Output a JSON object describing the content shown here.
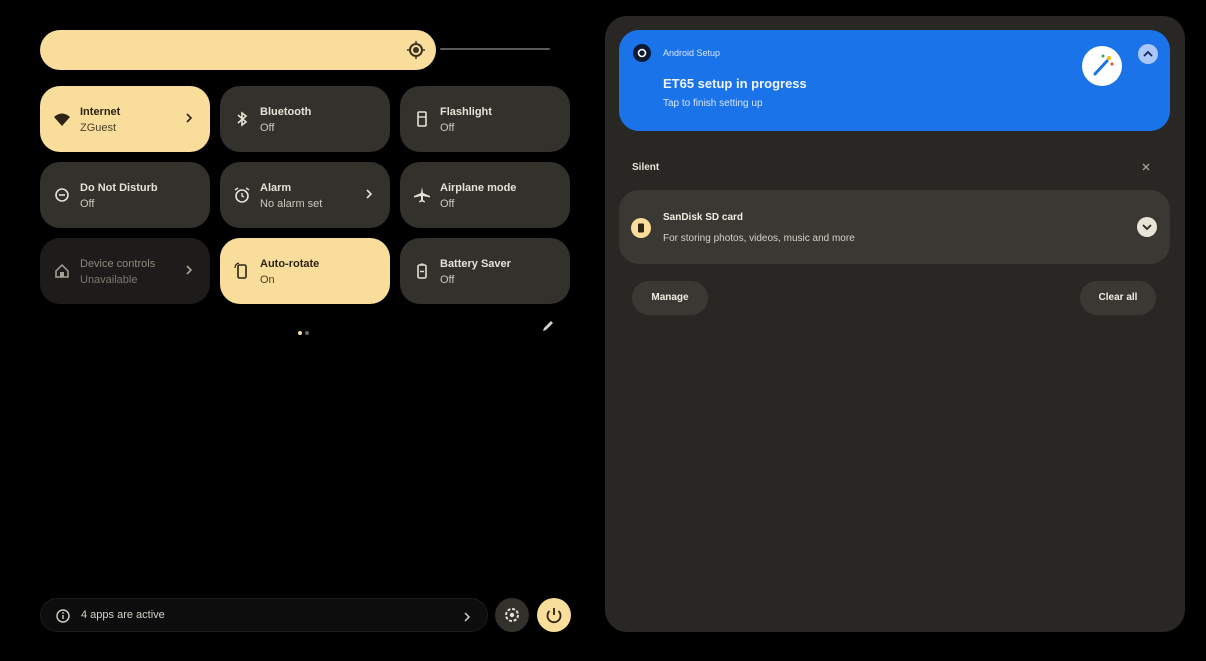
{
  "quick_settings": {
    "tiles": [
      {
        "title": "Internet",
        "subtitle": "ZGuest",
        "icon": "wifi-icon",
        "state": "on",
        "has_chevron": true
      },
      {
        "title": "Bluetooth",
        "subtitle": "Off",
        "icon": "bluetooth-icon",
        "state": "off"
      },
      {
        "title": "Flashlight",
        "subtitle": "Off",
        "icon": "flashlight-icon",
        "state": "off"
      },
      {
        "title": "Do Not Disturb",
        "subtitle": "Off",
        "icon": "do-not-disturb-icon",
        "state": "off"
      },
      {
        "title": "Alarm",
        "subtitle": "No alarm set",
        "icon": "alarm-icon",
        "state": "off",
        "has_chevron": true
      },
      {
        "title": "Airplane mode",
        "subtitle": "Off",
        "icon": "airplane-icon",
        "state": "off"
      },
      {
        "title": "Device controls",
        "subtitle": "Unavailable",
        "icon": "home-icon",
        "state": "unavailable",
        "has_chevron": true
      },
      {
        "title": "Auto-rotate",
        "subtitle": "On",
        "icon": "rotate-icon",
        "state": "on"
      },
      {
        "title": "Battery Saver",
        "subtitle": "Off",
        "icon": "battery-icon",
        "state": "off"
      }
    ],
    "page_indicator": {
      "pages": 2,
      "current": 1
    },
    "footer": {
      "active_apps_text": "4 apps are active"
    }
  },
  "notifications": {
    "setup": {
      "app_name": "Android Setup",
      "title": "ET65 setup in progress",
      "subtitle": "Tap to finish setting up"
    },
    "section_label": "Silent",
    "sd_card": {
      "title": "SanDisk SD card",
      "subtitle": "For storing photos, videos, music and more"
    },
    "actions": {
      "manage": "Manage",
      "clear_all": "Clear all"
    }
  },
  "colors": {
    "accent": "#f9dd9a",
    "tile_off": "#33312c",
    "setup_blue": "#1a73e8",
    "panel": "#282723"
  }
}
